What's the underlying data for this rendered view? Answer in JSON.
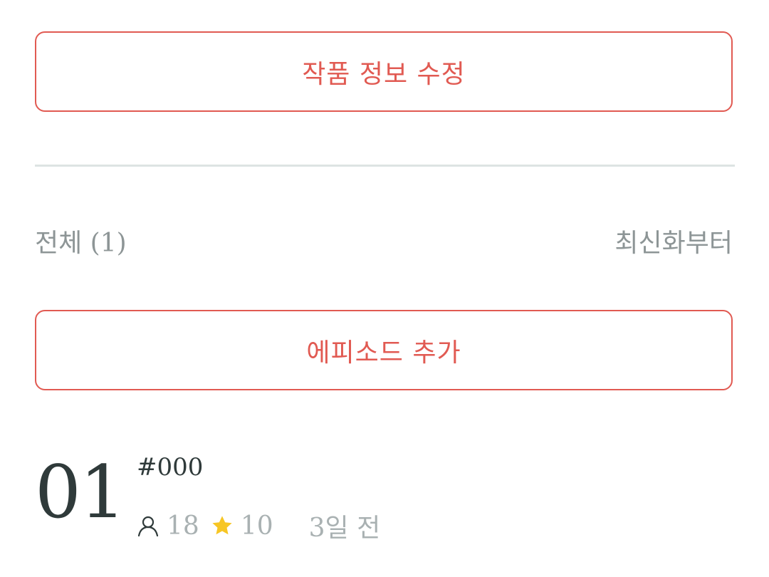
{
  "actions": {
    "edit_work_info": "작품 정보 수정",
    "add_episode": "에피소드 추가"
  },
  "list": {
    "total_label": "전체 (1)",
    "sort_label": "최신화부터"
  },
  "episodes": [
    {
      "number": "01",
      "title": "#000",
      "views": "18",
      "rating": "10",
      "time_ago": "3일 전",
      "icons": {
        "views": "person-icon",
        "rating": "star-icon"
      }
    }
  ],
  "colors": {
    "accent": "#e15a52",
    "star": "#f7c624",
    "muted_text": "#8d9596",
    "meta_text": "#a9b1b2",
    "dark_text": "#2f3a3a",
    "divider": "#dde4e3"
  }
}
